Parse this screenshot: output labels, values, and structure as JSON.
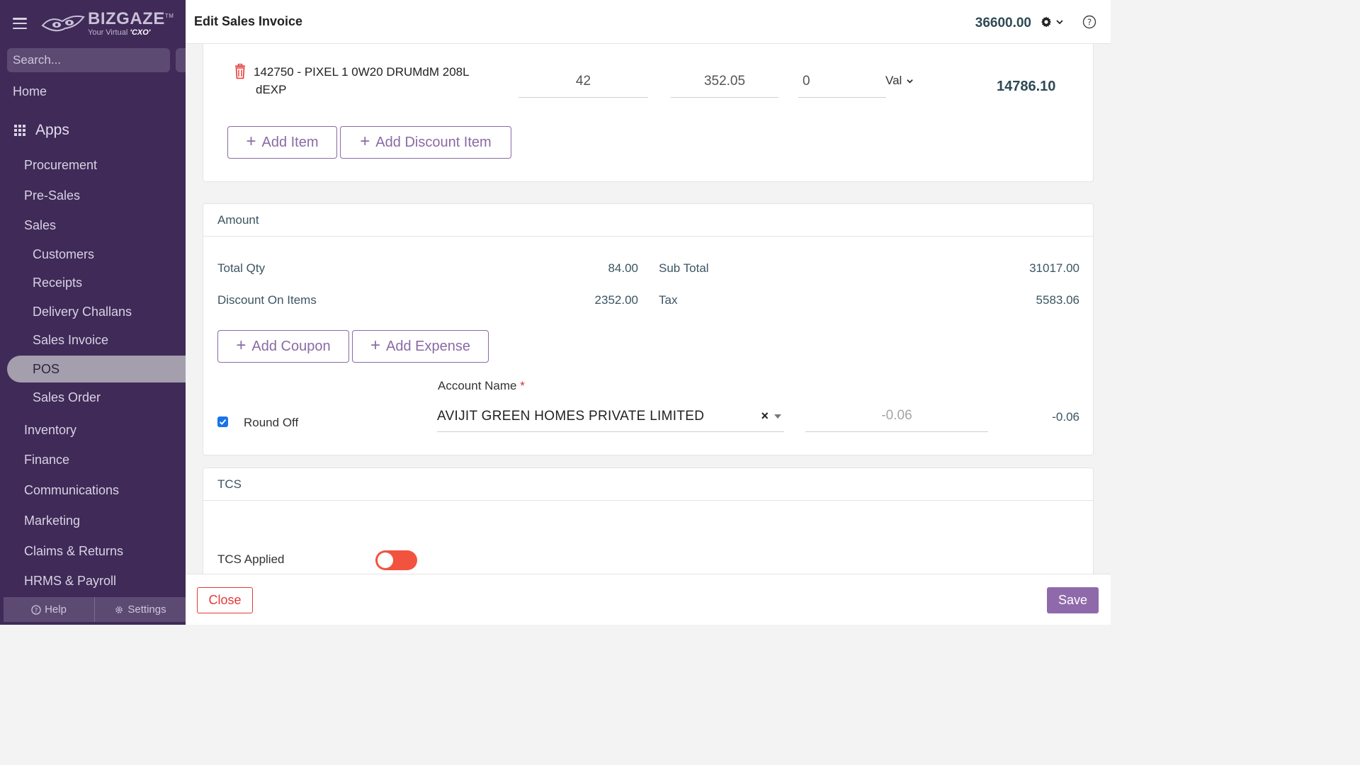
{
  "sidebar": {
    "brand_name": "BIZGAZE",
    "brand_tm": "TM",
    "brand_tagline_prefix": "Your Virtual ",
    "brand_tagline_emph": "'CXO'",
    "search_placeholder": "Search...",
    "home": "Home",
    "apps": "Apps",
    "items": [
      {
        "label": "Procurement"
      },
      {
        "label": "Pre-Sales"
      },
      {
        "label": "Sales"
      },
      {
        "label": "Customers"
      },
      {
        "label": "Receipts"
      },
      {
        "label": "Delivery Challans"
      },
      {
        "label": "Sales Invoice"
      },
      {
        "label": "POS"
      },
      {
        "label": "Sales Order"
      },
      {
        "label": "Inventory"
      },
      {
        "label": "Finance"
      },
      {
        "label": "Communications"
      },
      {
        "label": "Marketing"
      },
      {
        "label": "Claims & Returns"
      },
      {
        "label": "HRMS & Payroll"
      }
    ],
    "footer": {
      "help": "Help",
      "settings": "Settings"
    }
  },
  "header": {
    "title": "Edit Sales Invoice",
    "total": "36600.00"
  },
  "line_item": {
    "name_line1": "142750 - PIXEL 1 0W20 DRUMdM 208L",
    "name_line2": "dEXP",
    "qty": "42",
    "rate": "352.05",
    "discount": "0",
    "discount_type": "Val",
    "total": "14786.10"
  },
  "items_actions": {
    "add_item": "Add Item",
    "add_discount_item": "Add Discount Item"
  },
  "amount": {
    "section_title": "Amount",
    "total_qty_label": "Total Qty",
    "total_qty": "84.00",
    "sub_total_label": "Sub Total",
    "sub_total": "31017.00",
    "discount_label": "Discount On Items",
    "discount": "2352.00",
    "tax_label": "Tax",
    "tax": "5583.06",
    "add_coupon": "Add Coupon",
    "add_expense": "Add Expense",
    "account_label": "Account Name",
    "account_required": "*",
    "account_value": "AVIJIT GREEN HOMES PRIVATE LIMITED",
    "round_off_label": "Round Off",
    "round_off_checked": true,
    "round_off_input": "-0.06",
    "round_off_value": "-0.06"
  },
  "tcs": {
    "section_title": "TCS",
    "applied_label": "TCS Applied",
    "applied": false
  },
  "footer": {
    "close": "Close",
    "save": "Save"
  },
  "colors": {
    "sidebar_bg": "#3f2a58",
    "accent": "#8f6aab",
    "danger": "#e53935",
    "toggle_off": "#f2533e"
  }
}
